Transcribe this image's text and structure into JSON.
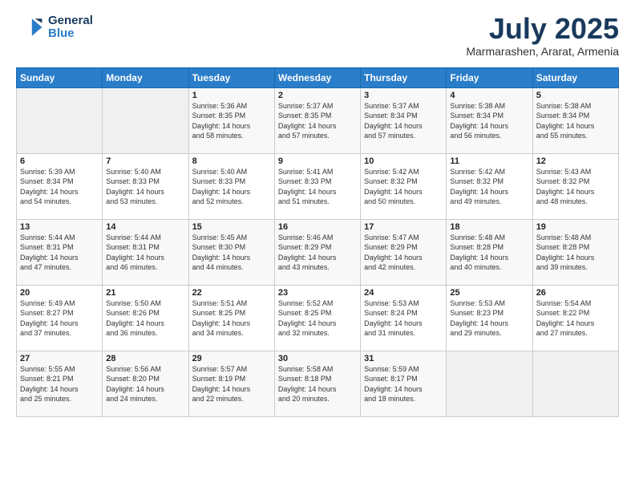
{
  "header": {
    "logo_line1": "General",
    "logo_line2": "Blue",
    "month_title": "July 2025",
    "location": "Marmarashen, Ararat, Armenia"
  },
  "weekdays": [
    "Sunday",
    "Monday",
    "Tuesday",
    "Wednesday",
    "Thursday",
    "Friday",
    "Saturday"
  ],
  "weeks": [
    [
      {
        "day": "",
        "info": ""
      },
      {
        "day": "",
        "info": ""
      },
      {
        "day": "1",
        "info": "Sunrise: 5:36 AM\nSunset: 8:35 PM\nDaylight: 14 hours\nand 58 minutes."
      },
      {
        "day": "2",
        "info": "Sunrise: 5:37 AM\nSunset: 8:35 PM\nDaylight: 14 hours\nand 57 minutes."
      },
      {
        "day": "3",
        "info": "Sunrise: 5:37 AM\nSunset: 8:34 PM\nDaylight: 14 hours\nand 57 minutes."
      },
      {
        "day": "4",
        "info": "Sunrise: 5:38 AM\nSunset: 8:34 PM\nDaylight: 14 hours\nand 56 minutes."
      },
      {
        "day": "5",
        "info": "Sunrise: 5:38 AM\nSunset: 8:34 PM\nDaylight: 14 hours\nand 55 minutes."
      }
    ],
    [
      {
        "day": "6",
        "info": "Sunrise: 5:39 AM\nSunset: 8:34 PM\nDaylight: 14 hours\nand 54 minutes."
      },
      {
        "day": "7",
        "info": "Sunrise: 5:40 AM\nSunset: 8:33 PM\nDaylight: 14 hours\nand 53 minutes."
      },
      {
        "day": "8",
        "info": "Sunrise: 5:40 AM\nSunset: 8:33 PM\nDaylight: 14 hours\nand 52 minutes."
      },
      {
        "day": "9",
        "info": "Sunrise: 5:41 AM\nSunset: 8:33 PM\nDaylight: 14 hours\nand 51 minutes."
      },
      {
        "day": "10",
        "info": "Sunrise: 5:42 AM\nSunset: 8:32 PM\nDaylight: 14 hours\nand 50 minutes."
      },
      {
        "day": "11",
        "info": "Sunrise: 5:42 AM\nSunset: 8:32 PM\nDaylight: 14 hours\nand 49 minutes."
      },
      {
        "day": "12",
        "info": "Sunrise: 5:43 AM\nSunset: 8:32 PM\nDaylight: 14 hours\nand 48 minutes."
      }
    ],
    [
      {
        "day": "13",
        "info": "Sunrise: 5:44 AM\nSunset: 8:31 PM\nDaylight: 14 hours\nand 47 minutes."
      },
      {
        "day": "14",
        "info": "Sunrise: 5:44 AM\nSunset: 8:31 PM\nDaylight: 14 hours\nand 46 minutes."
      },
      {
        "day": "15",
        "info": "Sunrise: 5:45 AM\nSunset: 8:30 PM\nDaylight: 14 hours\nand 44 minutes."
      },
      {
        "day": "16",
        "info": "Sunrise: 5:46 AM\nSunset: 8:29 PM\nDaylight: 14 hours\nand 43 minutes."
      },
      {
        "day": "17",
        "info": "Sunrise: 5:47 AM\nSunset: 8:29 PM\nDaylight: 14 hours\nand 42 minutes."
      },
      {
        "day": "18",
        "info": "Sunrise: 5:48 AM\nSunset: 8:28 PM\nDaylight: 14 hours\nand 40 minutes."
      },
      {
        "day": "19",
        "info": "Sunrise: 5:48 AM\nSunset: 8:28 PM\nDaylight: 14 hours\nand 39 minutes."
      }
    ],
    [
      {
        "day": "20",
        "info": "Sunrise: 5:49 AM\nSunset: 8:27 PM\nDaylight: 14 hours\nand 37 minutes."
      },
      {
        "day": "21",
        "info": "Sunrise: 5:50 AM\nSunset: 8:26 PM\nDaylight: 14 hours\nand 36 minutes."
      },
      {
        "day": "22",
        "info": "Sunrise: 5:51 AM\nSunset: 8:25 PM\nDaylight: 14 hours\nand 34 minutes."
      },
      {
        "day": "23",
        "info": "Sunrise: 5:52 AM\nSunset: 8:25 PM\nDaylight: 14 hours\nand 32 minutes."
      },
      {
        "day": "24",
        "info": "Sunrise: 5:53 AM\nSunset: 8:24 PM\nDaylight: 14 hours\nand 31 minutes."
      },
      {
        "day": "25",
        "info": "Sunrise: 5:53 AM\nSunset: 8:23 PM\nDaylight: 14 hours\nand 29 minutes."
      },
      {
        "day": "26",
        "info": "Sunrise: 5:54 AM\nSunset: 8:22 PM\nDaylight: 14 hours\nand 27 minutes."
      }
    ],
    [
      {
        "day": "27",
        "info": "Sunrise: 5:55 AM\nSunset: 8:21 PM\nDaylight: 14 hours\nand 25 minutes."
      },
      {
        "day": "28",
        "info": "Sunrise: 5:56 AM\nSunset: 8:20 PM\nDaylight: 14 hours\nand 24 minutes."
      },
      {
        "day": "29",
        "info": "Sunrise: 5:57 AM\nSunset: 8:19 PM\nDaylight: 14 hours\nand 22 minutes."
      },
      {
        "day": "30",
        "info": "Sunrise: 5:58 AM\nSunset: 8:18 PM\nDaylight: 14 hours\nand 20 minutes."
      },
      {
        "day": "31",
        "info": "Sunrise: 5:59 AM\nSunset: 8:17 PM\nDaylight: 14 hours\nand 18 minutes."
      },
      {
        "day": "",
        "info": ""
      },
      {
        "day": "",
        "info": ""
      }
    ]
  ]
}
